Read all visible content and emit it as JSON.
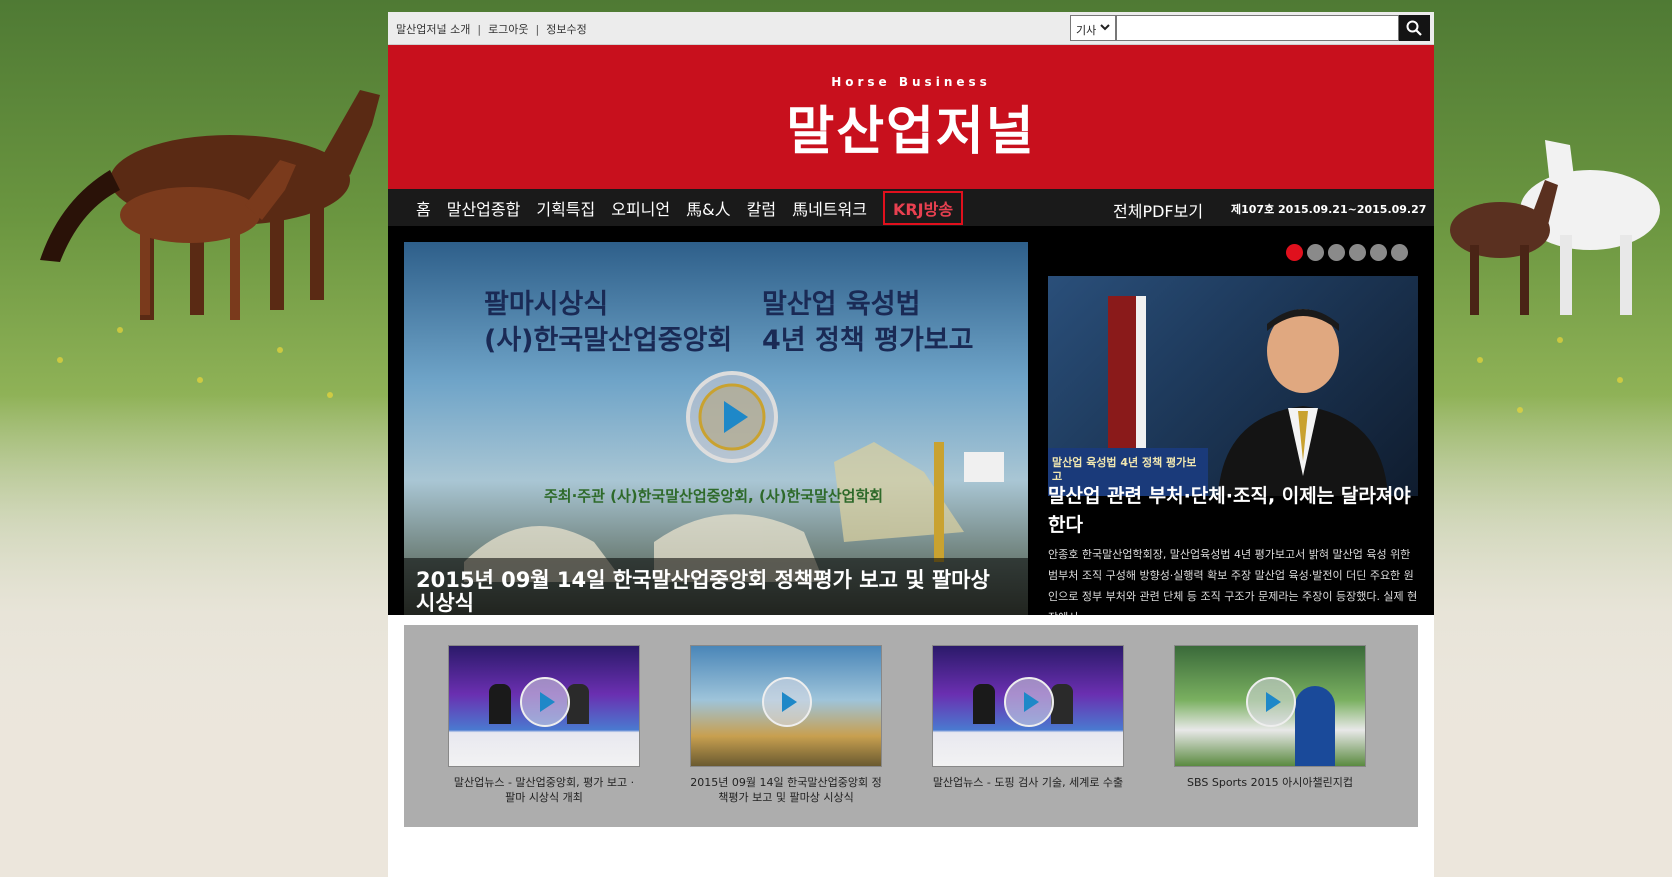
{
  "topbar": {
    "links": [
      "말산업저널 소개",
      "로그아웃",
      "정보수정"
    ],
    "search": {
      "category": "기사",
      "placeholder": ""
    }
  },
  "header": {
    "logo_sub": "Horse Business",
    "logo_main": "말산업저널"
  },
  "nav": {
    "items": [
      "홈",
      "말산업종합",
      "기획특집",
      "오피니언",
      "馬&人",
      "칼럼",
      "馬네트워크",
      "KRJ방송"
    ],
    "pdf": "전체PDF보기",
    "issue": "제107호 2015.09.21~2015.09.27"
  },
  "feature": {
    "video_title_left": "팔마시상식\n(사)한국말산업중앙회",
    "video_title_right": "말산업 육성법\n4년 정책 평가보고",
    "video_sub": "주최·주관 (사)한국말산업중앙회, (사)한국말산업학회",
    "caption": "2015년 09월 14일 한국말산업중앙회 정책평가 보고 및 팔마상 시상식",
    "slide_count": 6,
    "active_slide": 0,
    "side_headline": "말산업 관련 부처·단체·조직, 이제는 달라져야 한다",
    "side_body": "안종호 한국말산업학회장, 말산업육성법 4년 평가보고서 밝혀 말산업 육성 위한 범부처 조직 구성해 방향성·실행력 확보 주장 말산업 육성·발전이 더딘 주요한 원인으로 정부 부처와 관련 단체 등 조직 구조가 문제라는 주장이 등장했다. 실제 현장에서...",
    "side_podium": "말산업 육성법 4년 정책 평가보고"
  },
  "thumbs": [
    {
      "caption": "말산업뉴스 - 말산업중앙회, 평가 보고 · 팔마 시상식 개최",
      "kind": "studio"
    },
    {
      "caption": "2015년 09월 14일 한국말산업중앙회 정책평가 보고 및 팔마상 시상식",
      "kind": "event"
    },
    {
      "caption": "말산업뉴스 - 도핑 검사 기술, 세계로 수출",
      "kind": "studio"
    },
    {
      "caption": "SBS Sports 2015 아시아챌린지컵",
      "kind": "sports"
    }
  ],
  "colors": {
    "brand_red": "#c8101d",
    "nav_bg": "#1a1a1a",
    "accent": "#e0101d"
  }
}
